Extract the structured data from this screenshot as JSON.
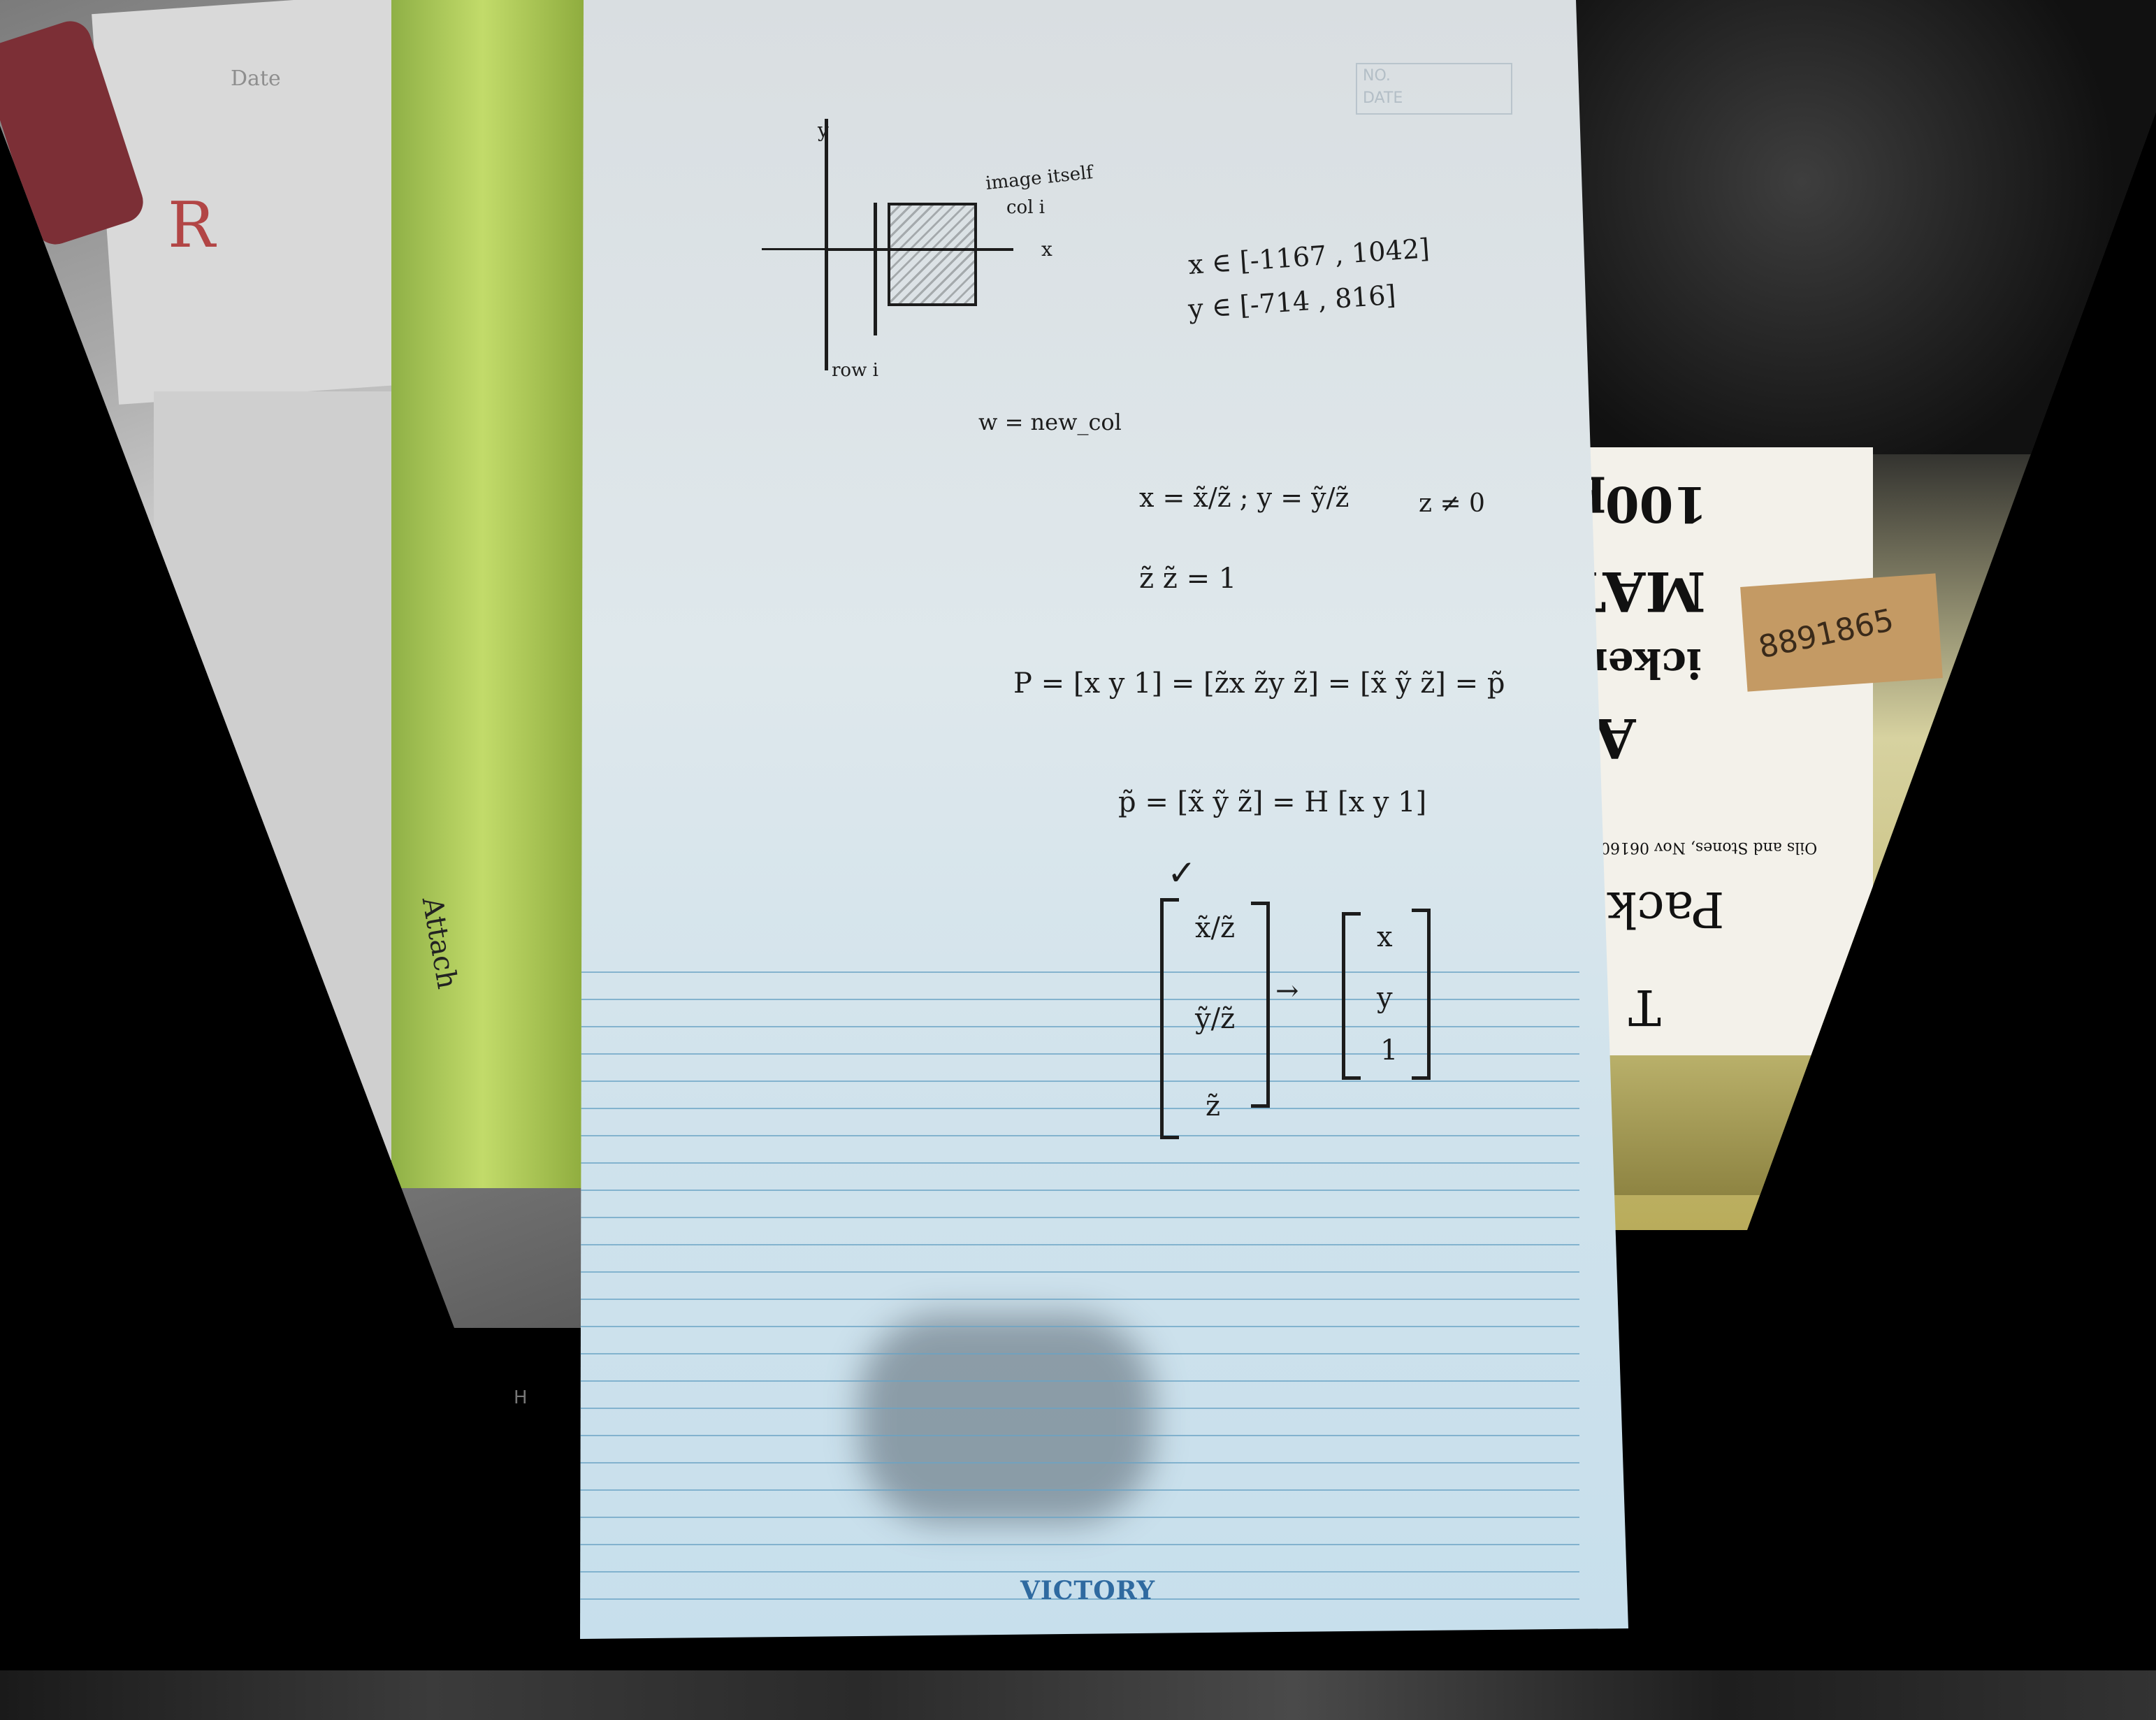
{
  "notepad": {
    "header": {
      "no_label": "NO.",
      "date_label": "DATE"
    },
    "brand": "VICTORY",
    "diagram": {
      "axis_y_label": "y",
      "axis_x_label": "x",
      "image_label": "image itself",
      "col_label": "col i",
      "row_label": "row i"
    },
    "ranges": {
      "x_range": "x ∈ [-1167 , 1042]",
      "y_range": "y ∈ [-714 , 816]"
    },
    "lines": {
      "w_def": "w = new_col",
      "xy_def": "x = x̃/z̃ ; y = ỹ/z̃",
      "z_cond": "z ≠ 0",
      "z_note": "z̃  z̃ = 1",
      "p_eq": "P = [x y 1] = [z̃x z̃y z̃] = [x̃ ỹ z̃] = p̃",
      "ptilde_eq": "p̃ = [x̃ ỹ z̃] = H [x y 1]",
      "check": "✓",
      "vec_left": [
        "x̃/z̃",
        "ỹ/z̃",
        "z̃"
      ],
      "arrow": "→",
      "vec_right": [
        "x",
        "y",
        "1"
      ]
    }
  },
  "background": {
    "left_note_1": "R",
    "left_note_2": "Date",
    "left_note_3": "Attach",
    "right_box_lines": [
      "100p",
      "MAT",
      "icker",
      "A",
      "Oils and Stones, Nov 06160",
      "Pack",
      "T"
    ],
    "tape_number": "8891865",
    "bottom_key": "H"
  }
}
